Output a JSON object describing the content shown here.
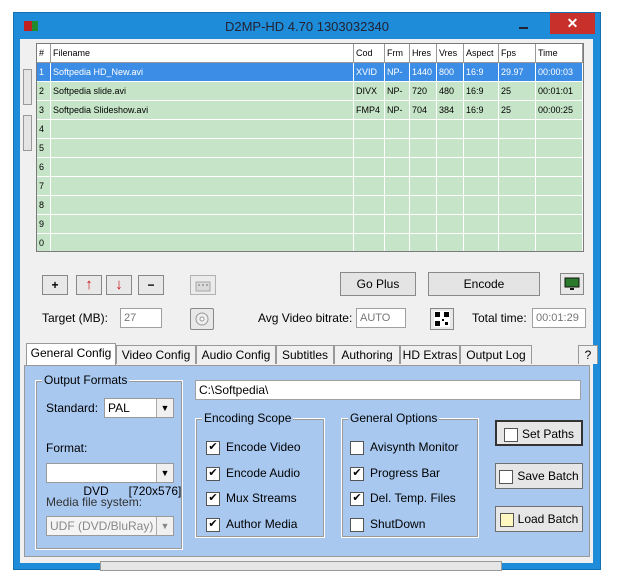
{
  "window": {
    "title": "D2MP-HD 4.70 1303032340",
    "close_label": "✕"
  },
  "grid": {
    "headers": [
      "#",
      "Filename",
      "Cod",
      "Frm",
      "Hres",
      "Vres",
      "Aspect",
      "Fps",
      "Time"
    ],
    "rows": [
      [
        "1",
        "Softpedia HD_New.avi",
        "XVID",
        "NP-",
        "1440",
        "800",
        "16:9",
        "29.97",
        "00:00:03"
      ],
      [
        "2",
        "Softpedia slide.avi",
        "DIVX",
        "NP-",
        "720",
        "480",
        "16:9",
        "25",
        "00:01:01"
      ],
      [
        "3",
        "Softpedia Slideshow.avi",
        "FMP4",
        "NP-",
        "704",
        "384",
        "16:9",
        "25",
        "00:00:25"
      ],
      [
        "4",
        "",
        "",
        "",
        "",
        "",
        "",
        "",
        ""
      ],
      [
        "5",
        "",
        "",
        "",
        "",
        "",
        "",
        "",
        ""
      ],
      [
        "6",
        "",
        "",
        "",
        "",
        "",
        "",
        "",
        ""
      ],
      [
        "7",
        "",
        "",
        "",
        "",
        "",
        "",
        "",
        ""
      ],
      [
        "8",
        "",
        "",
        "",
        "",
        "",
        "",
        "",
        ""
      ],
      [
        "9",
        "",
        "",
        "",
        "",
        "",
        "",
        "",
        ""
      ],
      [
        "0",
        "",
        "",
        "",
        "",
        "",
        "",
        "",
        ""
      ]
    ]
  },
  "toolbar": {
    "add": "+",
    "up": "↑",
    "down": "↓",
    "remove": "−",
    "go_plus": "Go Plus",
    "encode": "Encode"
  },
  "info": {
    "target_label": "Target (MB):",
    "target_value": "27",
    "avg_label": "Avg Video bitrate:",
    "avg_value": "AUTO",
    "total_label": "Total time:",
    "total_value": "00:01:29"
  },
  "tabs": [
    "General Config",
    "Video Config",
    "Audio Config",
    "Subtitles",
    "Authoring",
    "HD Extras",
    "Output Log"
  ],
  "help_label": "?",
  "general": {
    "output_formats_title": "Output Formats",
    "standard_label": "Standard:",
    "standard_value": "PAL",
    "format_label": "Format:",
    "format_value": "DVD      [720x576]",
    "media_label": "Media file system:",
    "media_value": "UDF (DVD/BluRay)",
    "path_value": "C:\\Softpedia\\",
    "encoding_title": "Encoding Scope",
    "encoding_items": [
      "Encode Video",
      "Encode Audio",
      "Mux Streams",
      "Author Media"
    ],
    "options_title": "General Options",
    "options_items": [
      "Avisynth Monitor",
      "Progress Bar",
      "Del. Temp. Files",
      "ShutDown"
    ],
    "set_paths": "Set Paths",
    "save_batch": "Save Batch",
    "load_batch": "Load Batch"
  },
  "checkmark": "✔",
  "colors": {
    "titlebar": "#1e8cd8",
    "grid_bg": "#c6e4c7",
    "selected_row": "#3c8de6",
    "panel_bg": "#a8c8f0",
    "close": "#c7302b",
    "up_down_arrow": "#d01010"
  }
}
